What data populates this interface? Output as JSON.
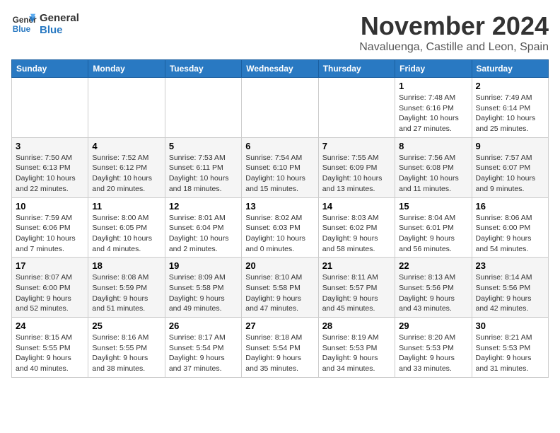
{
  "logo": {
    "line1": "General",
    "line2": "Blue"
  },
  "title": "November 2024",
  "location": "Navaluenga, Castille and Leon, Spain",
  "days_of_week": [
    "Sunday",
    "Monday",
    "Tuesday",
    "Wednesday",
    "Thursday",
    "Friday",
    "Saturday"
  ],
  "weeks": [
    [
      {
        "day": "",
        "info": ""
      },
      {
        "day": "",
        "info": ""
      },
      {
        "day": "",
        "info": ""
      },
      {
        "day": "",
        "info": ""
      },
      {
        "day": "",
        "info": ""
      },
      {
        "day": "1",
        "info": "Sunrise: 7:48 AM\nSunset: 6:16 PM\nDaylight: 10 hours and 27 minutes."
      },
      {
        "day": "2",
        "info": "Sunrise: 7:49 AM\nSunset: 6:14 PM\nDaylight: 10 hours and 25 minutes."
      }
    ],
    [
      {
        "day": "3",
        "info": "Sunrise: 7:50 AM\nSunset: 6:13 PM\nDaylight: 10 hours and 22 minutes."
      },
      {
        "day": "4",
        "info": "Sunrise: 7:52 AM\nSunset: 6:12 PM\nDaylight: 10 hours and 20 minutes."
      },
      {
        "day": "5",
        "info": "Sunrise: 7:53 AM\nSunset: 6:11 PM\nDaylight: 10 hours and 18 minutes."
      },
      {
        "day": "6",
        "info": "Sunrise: 7:54 AM\nSunset: 6:10 PM\nDaylight: 10 hours and 15 minutes."
      },
      {
        "day": "7",
        "info": "Sunrise: 7:55 AM\nSunset: 6:09 PM\nDaylight: 10 hours and 13 minutes."
      },
      {
        "day": "8",
        "info": "Sunrise: 7:56 AM\nSunset: 6:08 PM\nDaylight: 10 hours and 11 minutes."
      },
      {
        "day": "9",
        "info": "Sunrise: 7:57 AM\nSunset: 6:07 PM\nDaylight: 10 hours and 9 minutes."
      }
    ],
    [
      {
        "day": "10",
        "info": "Sunrise: 7:59 AM\nSunset: 6:06 PM\nDaylight: 10 hours and 7 minutes."
      },
      {
        "day": "11",
        "info": "Sunrise: 8:00 AM\nSunset: 6:05 PM\nDaylight: 10 hours and 4 minutes."
      },
      {
        "day": "12",
        "info": "Sunrise: 8:01 AM\nSunset: 6:04 PM\nDaylight: 10 hours and 2 minutes."
      },
      {
        "day": "13",
        "info": "Sunrise: 8:02 AM\nSunset: 6:03 PM\nDaylight: 10 hours and 0 minutes."
      },
      {
        "day": "14",
        "info": "Sunrise: 8:03 AM\nSunset: 6:02 PM\nDaylight: 9 hours and 58 minutes."
      },
      {
        "day": "15",
        "info": "Sunrise: 8:04 AM\nSunset: 6:01 PM\nDaylight: 9 hours and 56 minutes."
      },
      {
        "day": "16",
        "info": "Sunrise: 8:06 AM\nSunset: 6:00 PM\nDaylight: 9 hours and 54 minutes."
      }
    ],
    [
      {
        "day": "17",
        "info": "Sunrise: 8:07 AM\nSunset: 6:00 PM\nDaylight: 9 hours and 52 minutes."
      },
      {
        "day": "18",
        "info": "Sunrise: 8:08 AM\nSunset: 5:59 PM\nDaylight: 9 hours and 51 minutes."
      },
      {
        "day": "19",
        "info": "Sunrise: 8:09 AM\nSunset: 5:58 PM\nDaylight: 9 hours and 49 minutes."
      },
      {
        "day": "20",
        "info": "Sunrise: 8:10 AM\nSunset: 5:58 PM\nDaylight: 9 hours and 47 minutes."
      },
      {
        "day": "21",
        "info": "Sunrise: 8:11 AM\nSunset: 5:57 PM\nDaylight: 9 hours and 45 minutes."
      },
      {
        "day": "22",
        "info": "Sunrise: 8:13 AM\nSunset: 5:56 PM\nDaylight: 9 hours and 43 minutes."
      },
      {
        "day": "23",
        "info": "Sunrise: 8:14 AM\nSunset: 5:56 PM\nDaylight: 9 hours and 42 minutes."
      }
    ],
    [
      {
        "day": "24",
        "info": "Sunrise: 8:15 AM\nSunset: 5:55 PM\nDaylight: 9 hours and 40 minutes."
      },
      {
        "day": "25",
        "info": "Sunrise: 8:16 AM\nSunset: 5:55 PM\nDaylight: 9 hours and 38 minutes."
      },
      {
        "day": "26",
        "info": "Sunrise: 8:17 AM\nSunset: 5:54 PM\nDaylight: 9 hours and 37 minutes."
      },
      {
        "day": "27",
        "info": "Sunrise: 8:18 AM\nSunset: 5:54 PM\nDaylight: 9 hours and 35 minutes."
      },
      {
        "day": "28",
        "info": "Sunrise: 8:19 AM\nSunset: 5:53 PM\nDaylight: 9 hours and 34 minutes."
      },
      {
        "day": "29",
        "info": "Sunrise: 8:20 AM\nSunset: 5:53 PM\nDaylight: 9 hours and 33 minutes."
      },
      {
        "day": "30",
        "info": "Sunrise: 8:21 AM\nSunset: 5:53 PM\nDaylight: 9 hours and 31 minutes."
      }
    ]
  ]
}
